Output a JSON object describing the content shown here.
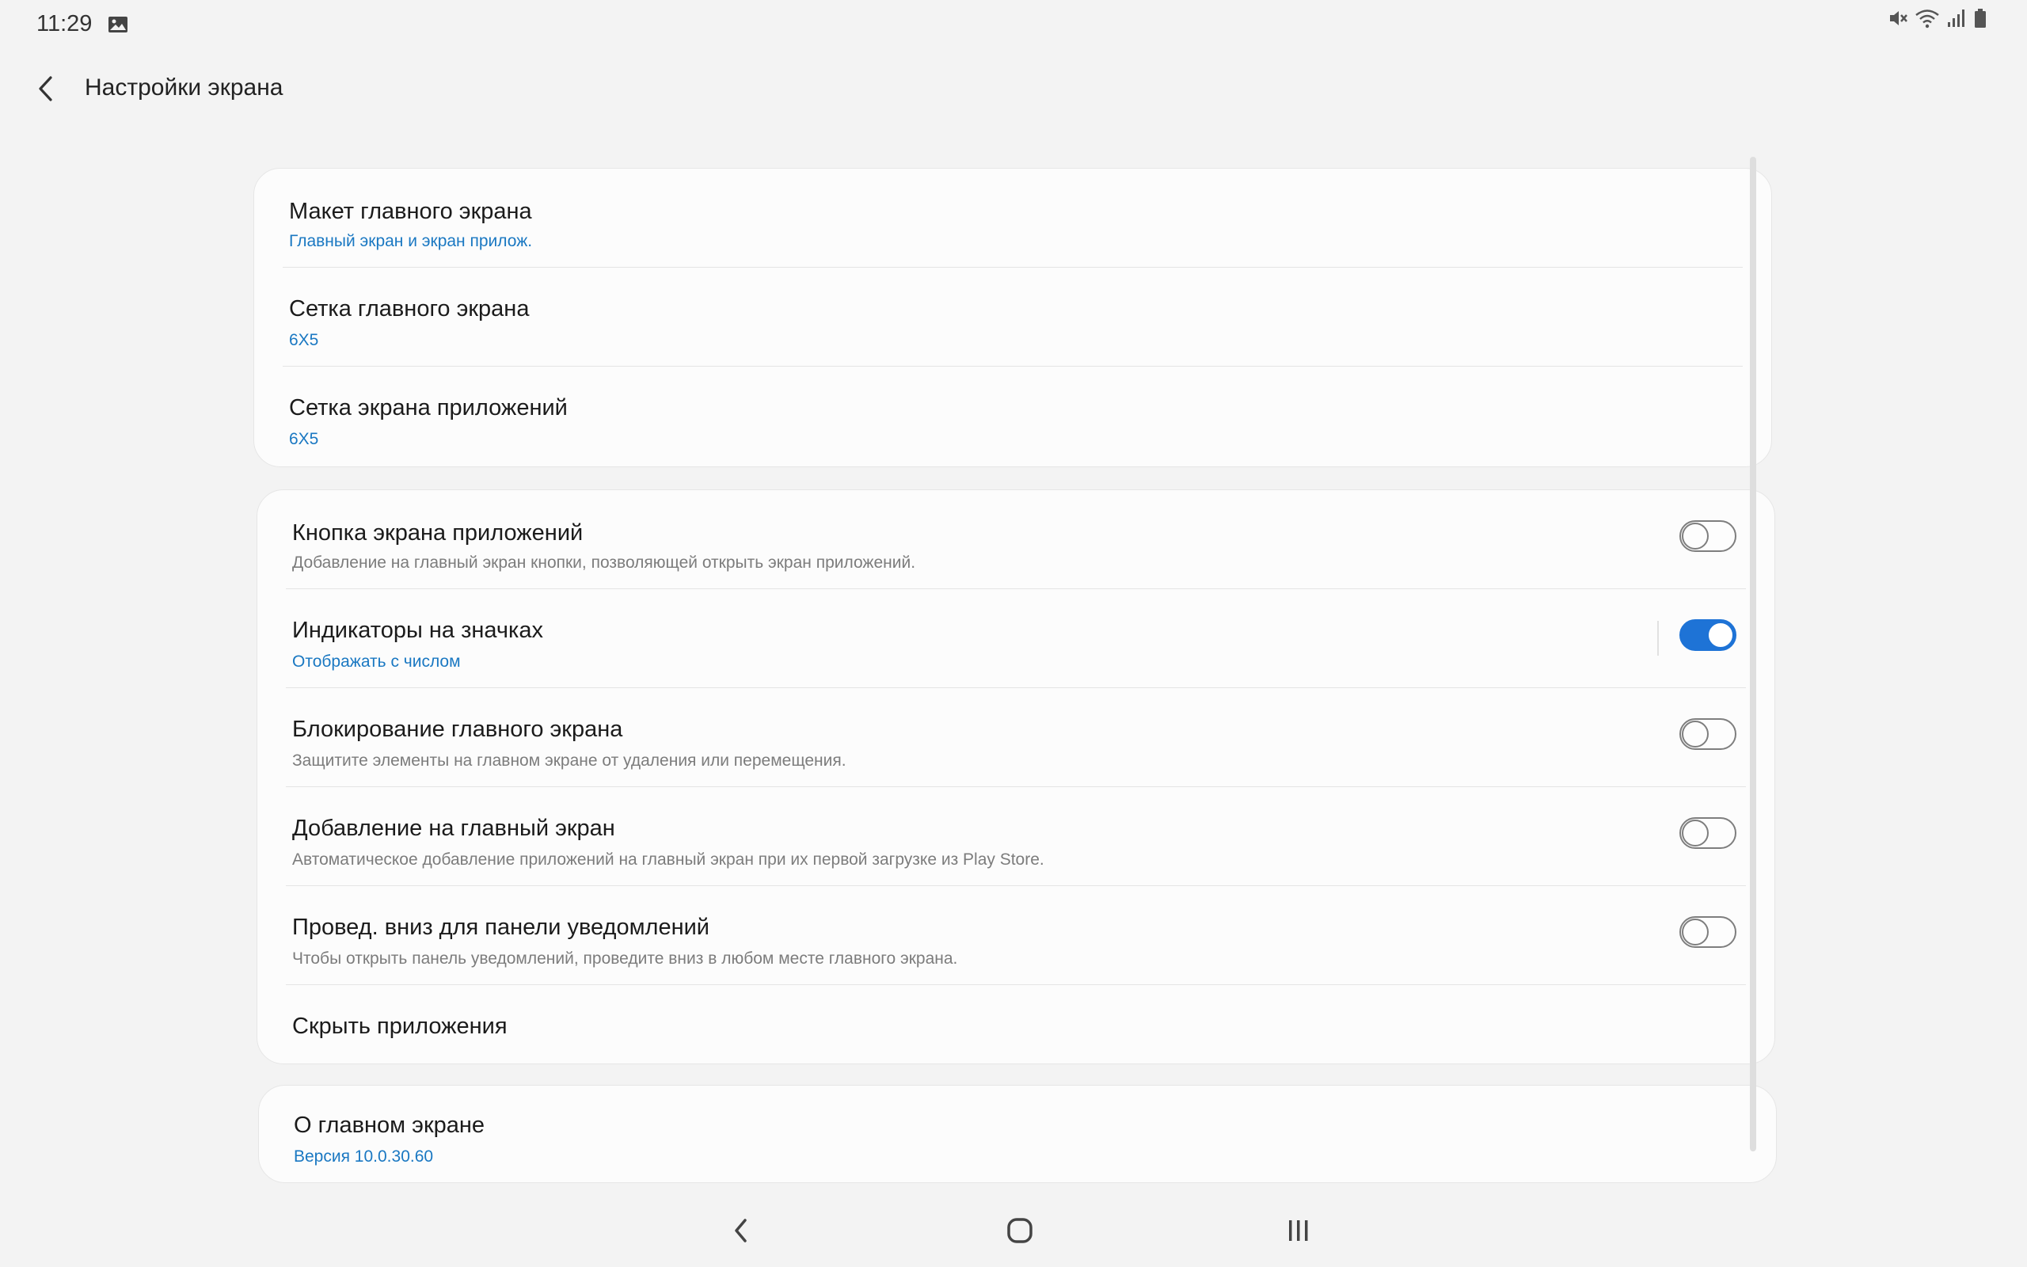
{
  "status_bar": {
    "time": "11:29",
    "icons": [
      "gallery-icon",
      "mute-icon",
      "wifi-icon",
      "signal-icon",
      "battery-icon"
    ]
  },
  "header": {
    "back_icon": "chevron-left-icon",
    "title": "Настройки экрана"
  },
  "groups": [
    {
      "items": [
        {
          "title": "Макет главного экрана",
          "subtitle": "Главный экран и экран прилож."
        },
        {
          "title": "Сетка главного экрана",
          "subtitle": "6X5"
        },
        {
          "title": "Сетка экрана приложений",
          "subtitle": "6X5"
        }
      ]
    },
    {
      "items": [
        {
          "title": "Кнопка экрана приложений",
          "subtitle": "Добавление на главный экран кнопки, позволяющей открыть экран приложений.",
          "toggle": false
        },
        {
          "title": "Индикаторы на значках",
          "subtitle": "Отображать с числом",
          "toggle": true
        },
        {
          "title": "Блокирование главного экрана",
          "subtitle": "Защитите элементы на главном экране от удаления или перемещения.",
          "toggle": false
        },
        {
          "title": "Добавление на главный экран",
          "subtitle": "Автоматическое добавление приложений на главный экран при их первой загрузке из Play Store.",
          "toggle": false
        },
        {
          "title": "Провед. вниз для панели уведомлений",
          "subtitle": "Чтобы открыть панель уведомлений, проведите вниз в любом месте главного экрана.",
          "toggle": false
        },
        {
          "title": "Скрыть приложения"
        }
      ]
    },
    {
      "items": [
        {
          "title": "О главном экране",
          "subtitle": "Версия 10.0.30.60"
        }
      ]
    }
  ],
  "nav_bar": {
    "buttons": [
      "back-icon",
      "home-icon",
      "recents-icon"
    ]
  },
  "colors": {
    "accent": "#1e73d6",
    "link_text": "#1a78c2",
    "background": "#f3f3f3"
  }
}
